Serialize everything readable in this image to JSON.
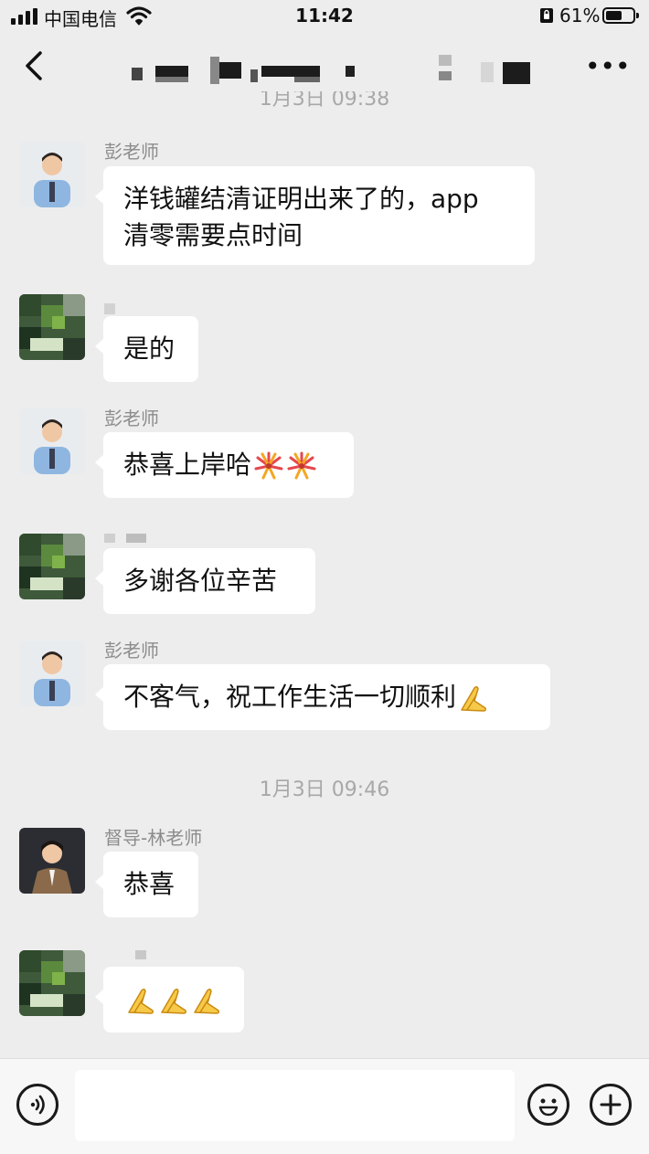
{
  "status_bar": {
    "carrier": "中国电信",
    "time": "11:42",
    "battery_percent": "61%",
    "battery_level": 0.61
  },
  "nav": {
    "back_icon": "chevron-left-icon",
    "title_obscured": true,
    "more_icon": "more-dots-icon",
    "more_label": "•••"
  },
  "messages": [
    {
      "sender": "彭老师",
      "text": "洋钱罐结清证明出来了的，app\n清零需要点时间"
    },
    {
      "sender": "",
      "text": "是的"
    },
    {
      "sender": "彭老师",
      "text": "恭喜上岸哈",
      "emoji": [
        "fireworks-icon",
        "fireworks-icon"
      ]
    },
    {
      "sender": "",
      "text": "多谢各位辛苦"
    },
    {
      "sender": "彭老师",
      "text": "不客气，祝工作生活一切顺利",
      "emoji": [
        "pray-hands-icon"
      ]
    },
    {
      "sender": "督导-林老师",
      "text": "恭喜"
    },
    {
      "sender": "",
      "text": "",
      "emoji": [
        "pray-hands-icon",
        "pray-hands-icon",
        "pray-hands-icon"
      ]
    }
  ],
  "timestamps": {
    "top_partial": "1月3日 09:38",
    "middle": "1月3日 09:46"
  },
  "input_bar": {
    "voice_icon": "voice-icon",
    "emoji_icon": "smiley-icon",
    "plus_icon": "plus-circle-icon",
    "placeholder": ""
  }
}
